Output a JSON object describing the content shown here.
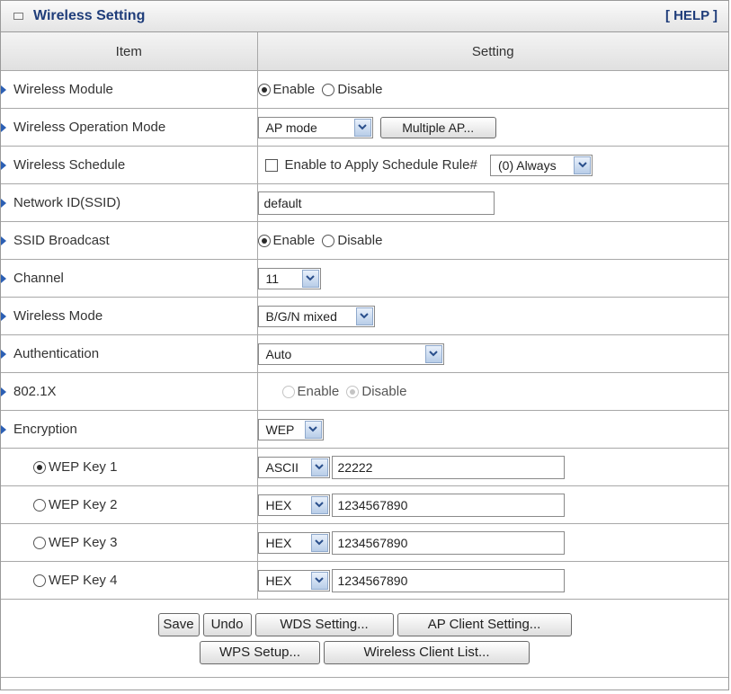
{
  "header": {
    "title": "Wireless Setting",
    "help": "[ HELP ]"
  },
  "columns": {
    "item": "Item",
    "setting": "Setting"
  },
  "rows": {
    "module": {
      "label": "Wireless Module",
      "enable": "Enable",
      "disable": "Disable",
      "selected": "Enable"
    },
    "op_mode": {
      "label": "Wireless Operation Mode",
      "value": "AP mode",
      "button": "Multiple AP..."
    },
    "schedule": {
      "label": "Wireless Schedule",
      "checkbox_label": "Enable to Apply Schedule Rule#",
      "checked": false,
      "value": "(0) Always"
    },
    "ssid": {
      "label": "Network ID(SSID)",
      "value": "default"
    },
    "ssid_broadcast": {
      "label": "SSID Broadcast",
      "enable": "Enable",
      "disable": "Disable",
      "selected": "Enable"
    },
    "channel": {
      "label": "Channel",
      "value": "11"
    },
    "wireless_mode": {
      "label": "Wireless Mode",
      "value": "B/G/N mixed"
    },
    "authentication": {
      "label": "Authentication",
      "value": "Auto"
    },
    "dot1x": {
      "label": "802.1X",
      "enable": "Enable",
      "disable": "Disable",
      "selected": "Disable",
      "disabled": true
    },
    "encryption": {
      "label": "Encryption",
      "value": "WEP"
    },
    "wep_keys": [
      {
        "label": "WEP Key 1",
        "selected": true,
        "format": "ASCII",
        "value": "22222"
      },
      {
        "label": "WEP Key 2",
        "selected": false,
        "format": "HEX",
        "value": "1234567890"
      },
      {
        "label": "WEP Key 3",
        "selected": false,
        "format": "HEX",
        "value": "1234567890"
      },
      {
        "label": "WEP Key 4",
        "selected": false,
        "format": "HEX",
        "value": "1234567890"
      }
    ]
  },
  "footer": {
    "save": "Save",
    "undo": "Undo",
    "wds": "WDS Setting...",
    "ap_client": "AP Client Setting...",
    "wps": "WPS Setup...",
    "client_list": "Wireless Client List..."
  },
  "colors": {
    "title_text": "#1f3d7a",
    "arrow": "#2b5fb4",
    "dropdown_button": "#b8cde8"
  }
}
